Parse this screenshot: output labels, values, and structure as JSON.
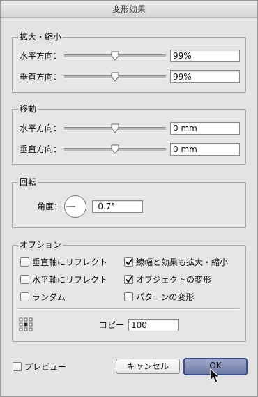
{
  "window": {
    "title": "変形効果"
  },
  "scale": {
    "legend": "拡大・縮小",
    "horizontal": {
      "label": "水平方向：",
      "value": "99%",
      "level_percent": 99
    },
    "vertical": {
      "label": "垂直方向：",
      "value": "99%",
      "level_percent": 99
    }
  },
  "move": {
    "legend": "移動",
    "horizontal": {
      "label": "水平方向：",
      "value": "0 mm"
    },
    "vertical": {
      "label": "垂直方向：",
      "value": "0 mm"
    }
  },
  "rotate": {
    "legend": "回転",
    "angle_label": "角度：",
    "angle_value": "-0.7°"
  },
  "options": {
    "legend": "オプション",
    "reflect_y": {
      "label": "垂直軸にリフレクト",
      "checked": false
    },
    "reflect_x": {
      "label": "水平軸にリフレクト",
      "checked": false
    },
    "random": {
      "label": "ランダム",
      "checked": false
    },
    "scale_strokes": {
      "label": "線幅と効果も拡大・縮小",
      "checked": true
    },
    "transform_objects": {
      "label": "オブジェクトの変形",
      "checked": true
    },
    "transform_patterns": {
      "label": "パターンの変形",
      "checked": false
    },
    "reference_point_icon": "reference-point-grid-icon",
    "copies_label": "コピー",
    "copies_value": "100"
  },
  "footer": {
    "preview": {
      "label": "プレビュー",
      "checked": false
    },
    "cancel_label": "キャンセル",
    "ok_label": "OK"
  },
  "colors": {
    "default_button": "#6d7aa5",
    "default_button_border": "#384c8f"
  }
}
